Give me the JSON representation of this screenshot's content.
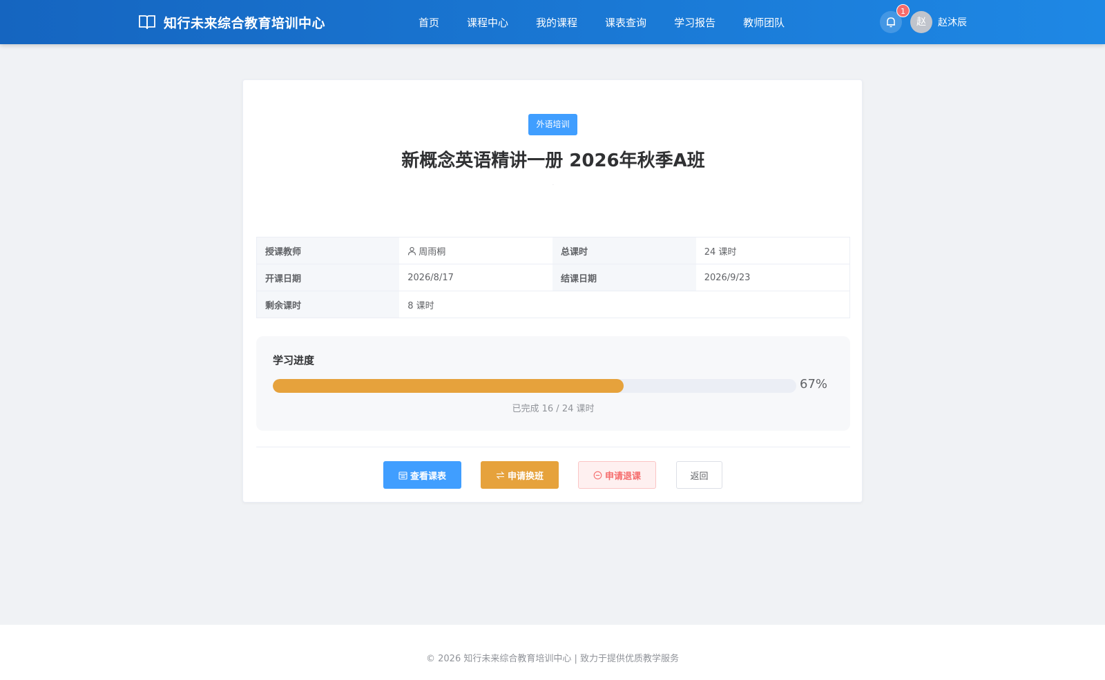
{
  "header": {
    "logo_text": "知行未来综合教育培训中心",
    "nav": [
      "首页",
      "课程中心",
      "我的课程",
      "课表查询",
      "学习报告",
      "教师团队"
    ],
    "notification_count": "1",
    "avatar_text": "赵",
    "username": "赵沐辰"
  },
  "course": {
    "tag": "外语培训",
    "title": "新概念英语精讲一册 2026年秋季A班",
    "subtitle": "·"
  },
  "info": {
    "teacher_label": "授课教师",
    "teacher_value": "周雨桐",
    "total_hours_label": "总课时",
    "total_hours_value": "24 课时",
    "start_label": "开课日期",
    "start_value": "2026/8/17",
    "end_label": "结课日期",
    "end_value": "2026/9/23",
    "remaining_label": "剩余课时",
    "remaining_value": "8 课时"
  },
  "progress": {
    "title": "学习进度",
    "percent": 67,
    "percent_text": "67%",
    "note": "已完成 16 / 24 课时"
  },
  "buttons": {
    "schedule": "查看课表",
    "transfer": "申请换班",
    "drop": "申请退课",
    "back": "返回"
  },
  "colors": {
    "header_start": "#1565c0",
    "header_end": "#1e88e5",
    "primary": "#409eff",
    "warning": "#e6a23c",
    "danger": "#f56c6c"
  },
  "footer": {
    "text": "© 2026 知行未来综合教育培训中心 | 致力于提供优质教学服务"
  }
}
